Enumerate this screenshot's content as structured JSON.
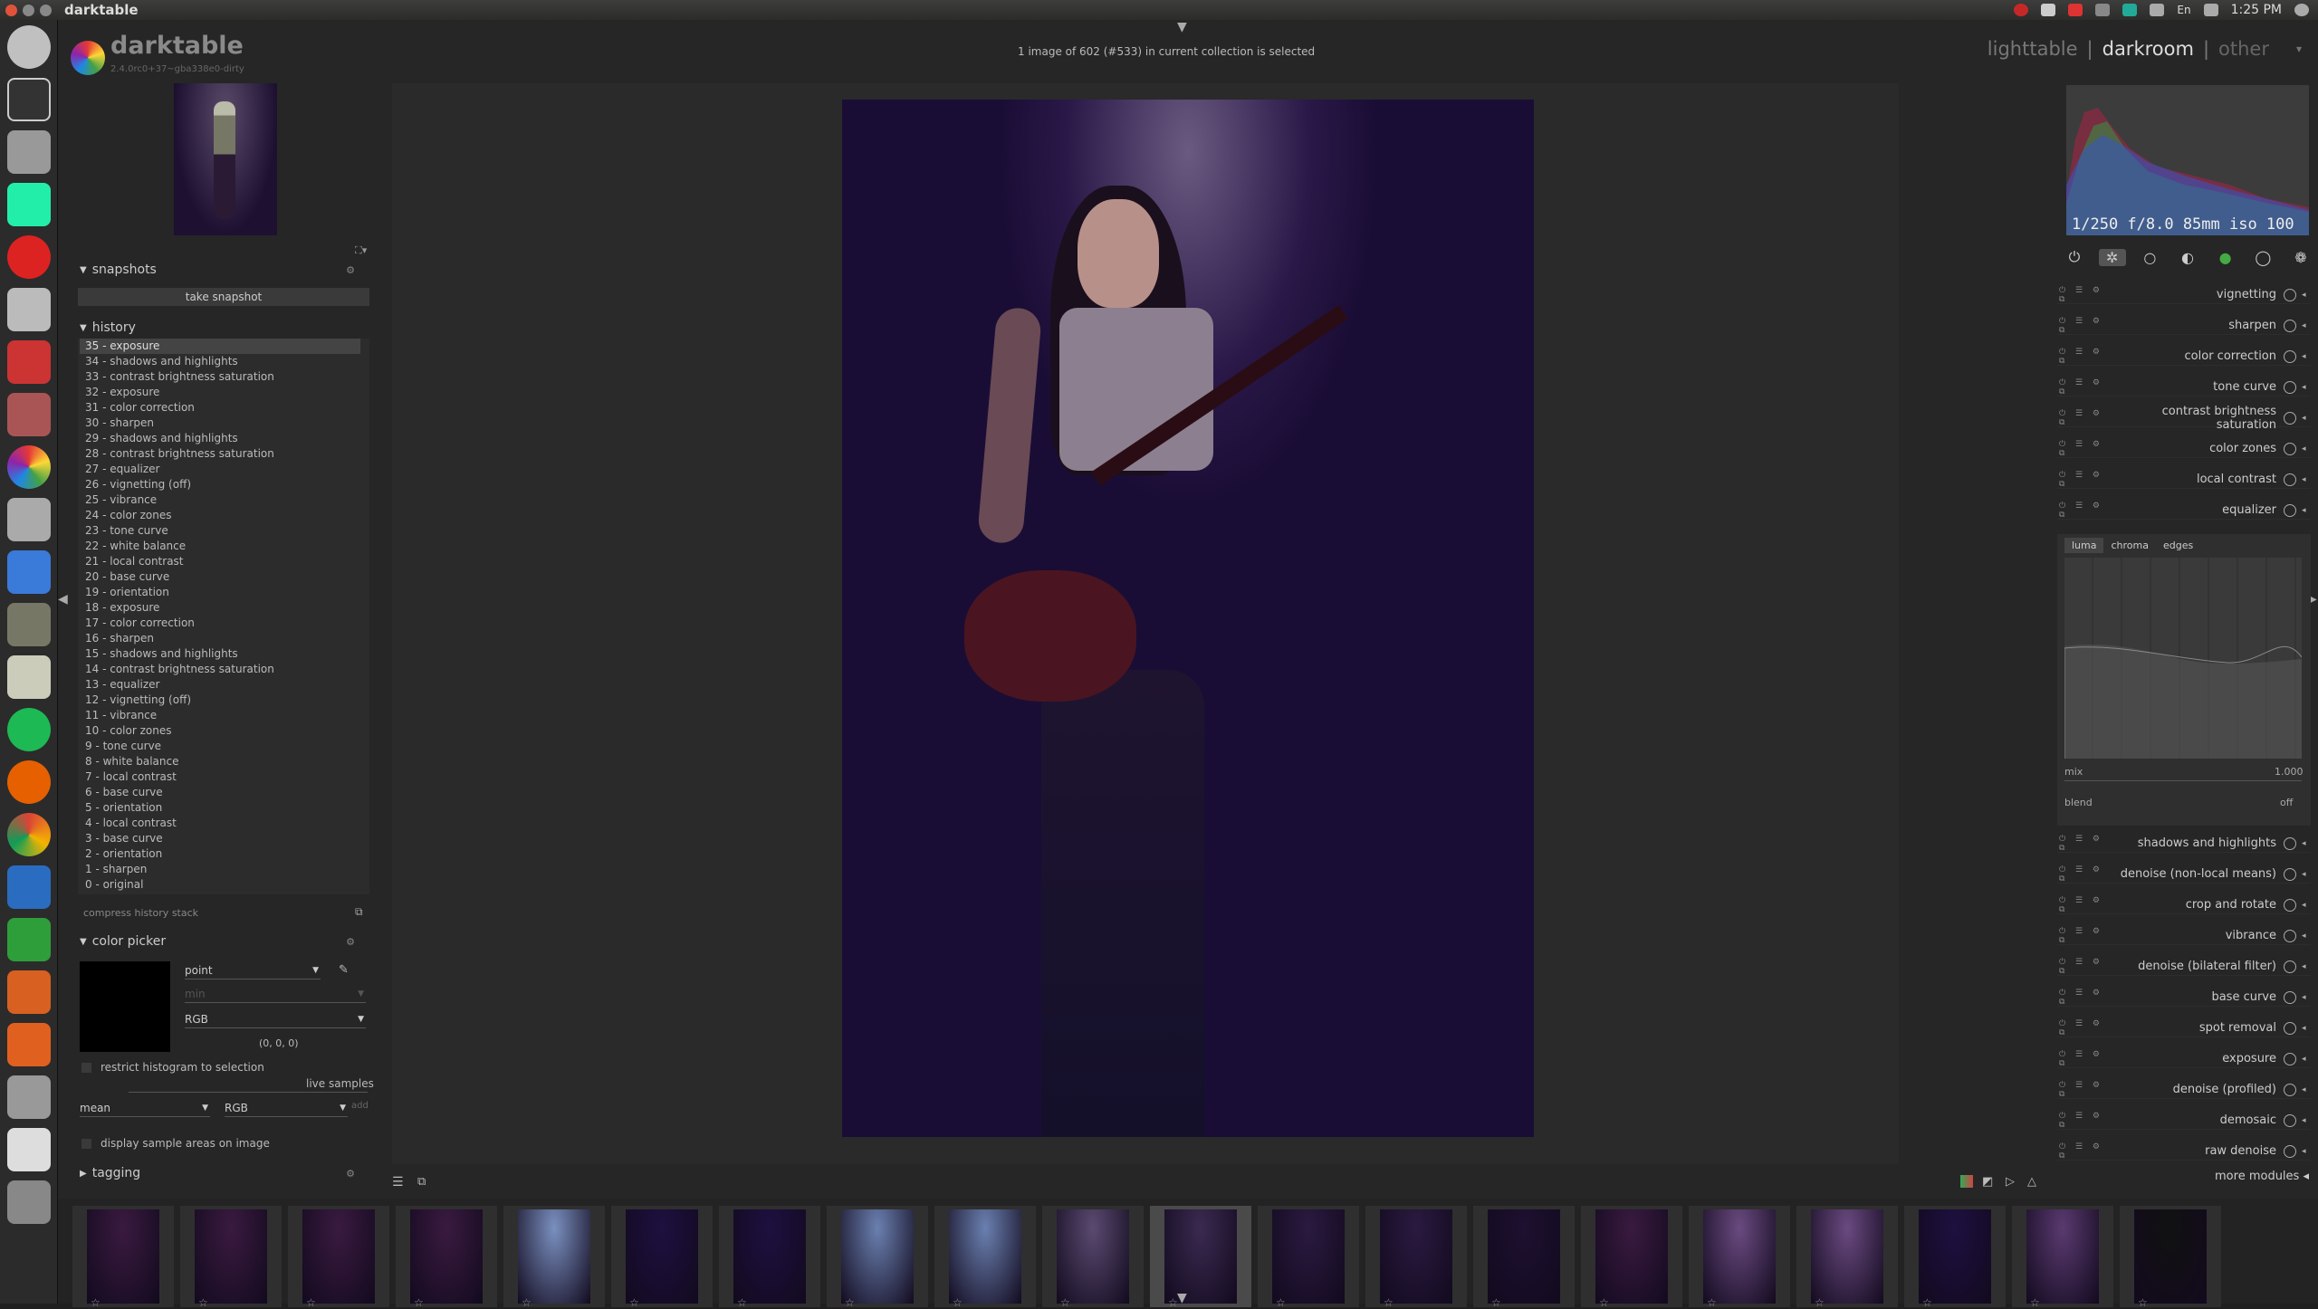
{
  "window": {
    "title": "darktable"
  },
  "tray": {
    "time": "1:25 PM",
    "lang": "En"
  },
  "logo": {
    "name": "darktable",
    "version": "2.4.0rc0+37~gba338e0-dirty"
  },
  "status": {
    "text": "1 image of 602 (#533) in current collection is selected"
  },
  "views": {
    "lighttable": "lighttable",
    "darkroom": "darkroom",
    "other": "other",
    "sep": "|"
  },
  "snapshots": {
    "title": "snapshots",
    "take": "take snapshot"
  },
  "history": {
    "title": "history",
    "items": [
      "35 - exposure",
      "34 - shadows and highlights",
      "33 - contrast brightness saturation",
      "32 - exposure",
      "31 - color correction",
      "30 - sharpen",
      "29 - shadows and highlights",
      "28 - contrast brightness saturation",
      "27 - equalizer",
      "26 - vignetting (off)",
      "25 - vibrance",
      "24 - color zones",
      "23 - tone curve",
      "22 - white balance",
      "21 - local contrast",
      "20 - base curve",
      "19 - orientation",
      "18 - exposure",
      "17 - color correction",
      "16 - sharpen",
      "15 - shadows and highlights",
      "14 - contrast brightness saturation",
      "13 - equalizer",
      "12 - vignetting (off)",
      "11 - vibrance",
      "10 - color zones",
      "9 - tone curve",
      "8 - white balance",
      "7 - local contrast",
      "6 - base curve",
      "5 - orientation",
      "4 - local contrast",
      "3 - base curve",
      "2 - orientation",
      "1 - sharpen",
      "0 - original"
    ],
    "compress": "compress history stack"
  },
  "colorpicker": {
    "title": "color picker",
    "mode": "point",
    "stat": "min",
    "model": "RGB",
    "value": "(0, 0, 0)",
    "restrict": "restrict histogram to selection",
    "live": "live samples",
    "sample_stat": "mean",
    "sample_model": "RGB",
    "add": "add",
    "display": "display sample areas on image"
  },
  "tagging": {
    "title": "tagging"
  },
  "histogram": {
    "exif": "1/250 f/8.0 85mm iso 100"
  },
  "modules_top": [
    "vignetting",
    "sharpen",
    "color correction",
    "tone curve",
    "contrast brightness saturation",
    "color zones",
    "local contrast",
    "equalizer"
  ],
  "equalizer": {
    "tabs": [
      "luma",
      "chroma",
      "edges"
    ],
    "mix_label": "mix",
    "mix_value": "1.000",
    "blend_label": "blend",
    "blend_value": "off"
  },
  "modules_bottom": [
    "shadows and highlights",
    "denoise (non-local means)",
    "crop and rotate",
    "vibrance",
    "denoise (bilateral filter)",
    "base curve",
    "spot removal",
    "exposure",
    "denoise (profiled)",
    "demosaic",
    "raw denoise"
  ],
  "more_modules": "more modules",
  "filmstrip_count": 20,
  "colors": {
    "accent": "#ddd",
    "bg": "#262626",
    "photo_bg": "#1a0d35"
  }
}
